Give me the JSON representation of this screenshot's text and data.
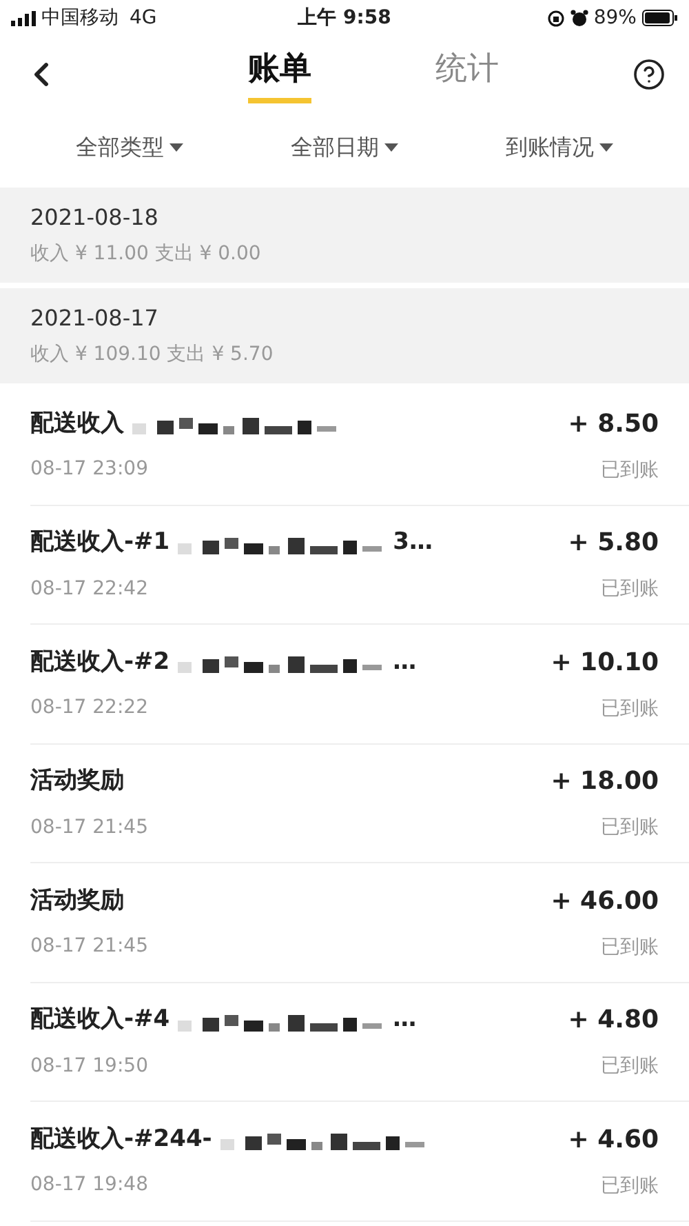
{
  "status_bar": {
    "carrier": "中国移动",
    "network": "4G",
    "time": "上午 9:58",
    "battery": "89%"
  },
  "tabs": [
    {
      "label": "账单",
      "selected": true
    },
    {
      "label": "统计",
      "selected": false
    }
  ],
  "filters": [
    {
      "label": "全部类型"
    },
    {
      "label": "全部日期"
    },
    {
      "label": "到账情况"
    }
  ],
  "groups": [
    {
      "date": "2021-08-18",
      "summary": "收入 ¥ 11.00 支出 ¥ 0.00"
    },
    {
      "date": "2021-08-17",
      "summary": "收入 ¥ 109.10 支出 ¥ 5.70"
    }
  ],
  "records": [
    {
      "title": "配送收入",
      "redacted": true,
      "time": "08-17 23:09",
      "amount": "+ 8.50",
      "status": "已到账"
    },
    {
      "title": "配送收入-#1",
      "redacted": true,
      "suffix": "3…",
      "time": "08-17 22:42",
      "amount": "+ 5.80",
      "status": "已到账"
    },
    {
      "title": "配送收入-#2",
      "redacted": true,
      "suffix": "…",
      "time": "08-17 22:22",
      "amount": "+ 10.10",
      "status": "已到账"
    },
    {
      "title": "活动奖励",
      "redacted": false,
      "time": "08-17 21:45",
      "amount": "+ 18.00",
      "status": "已到账"
    },
    {
      "title": "活动奖励",
      "redacted": false,
      "time": "08-17 21:45",
      "amount": "+ 46.00",
      "status": "已到账"
    },
    {
      "title": "配送收入-#4",
      "redacted": true,
      "suffix": "…",
      "time": "08-17 19:50",
      "amount": "+ 4.80",
      "status": "已到账"
    },
    {
      "title": "配送收入-#244-",
      "redacted": true,
      "time": "08-17 19:48",
      "amount": "+ 4.60",
      "status": "已到账"
    }
  ]
}
